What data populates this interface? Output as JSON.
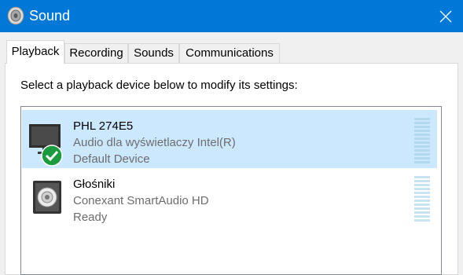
{
  "window": {
    "title": "Sound",
    "close_icon": "close-icon",
    "app_icon": "speaker-icon"
  },
  "tabs": [
    {
      "label": "Playback",
      "active": true
    },
    {
      "label": "Recording",
      "active": false
    },
    {
      "label": "Sounds",
      "active": false
    },
    {
      "label": "Communications",
      "active": false
    }
  ],
  "playback": {
    "instruction": "Select a playback device below to modify its settings:",
    "devices": [
      {
        "name": "PHL 274E5",
        "description": "Audio dla wyświetlaczy Intel(R)",
        "status": "Default Device",
        "icon": "monitor-icon",
        "badge": "default-check-icon",
        "selected": true
      },
      {
        "name": "Głośniki",
        "description": "Conexant SmartAudio HD",
        "status": "Ready",
        "icon": "speaker-box-icon",
        "selected": false
      }
    ]
  },
  "colors": {
    "titlebar": "#0078d7",
    "selection": "#cce8ff",
    "check_badge": "#1a9c3e"
  }
}
